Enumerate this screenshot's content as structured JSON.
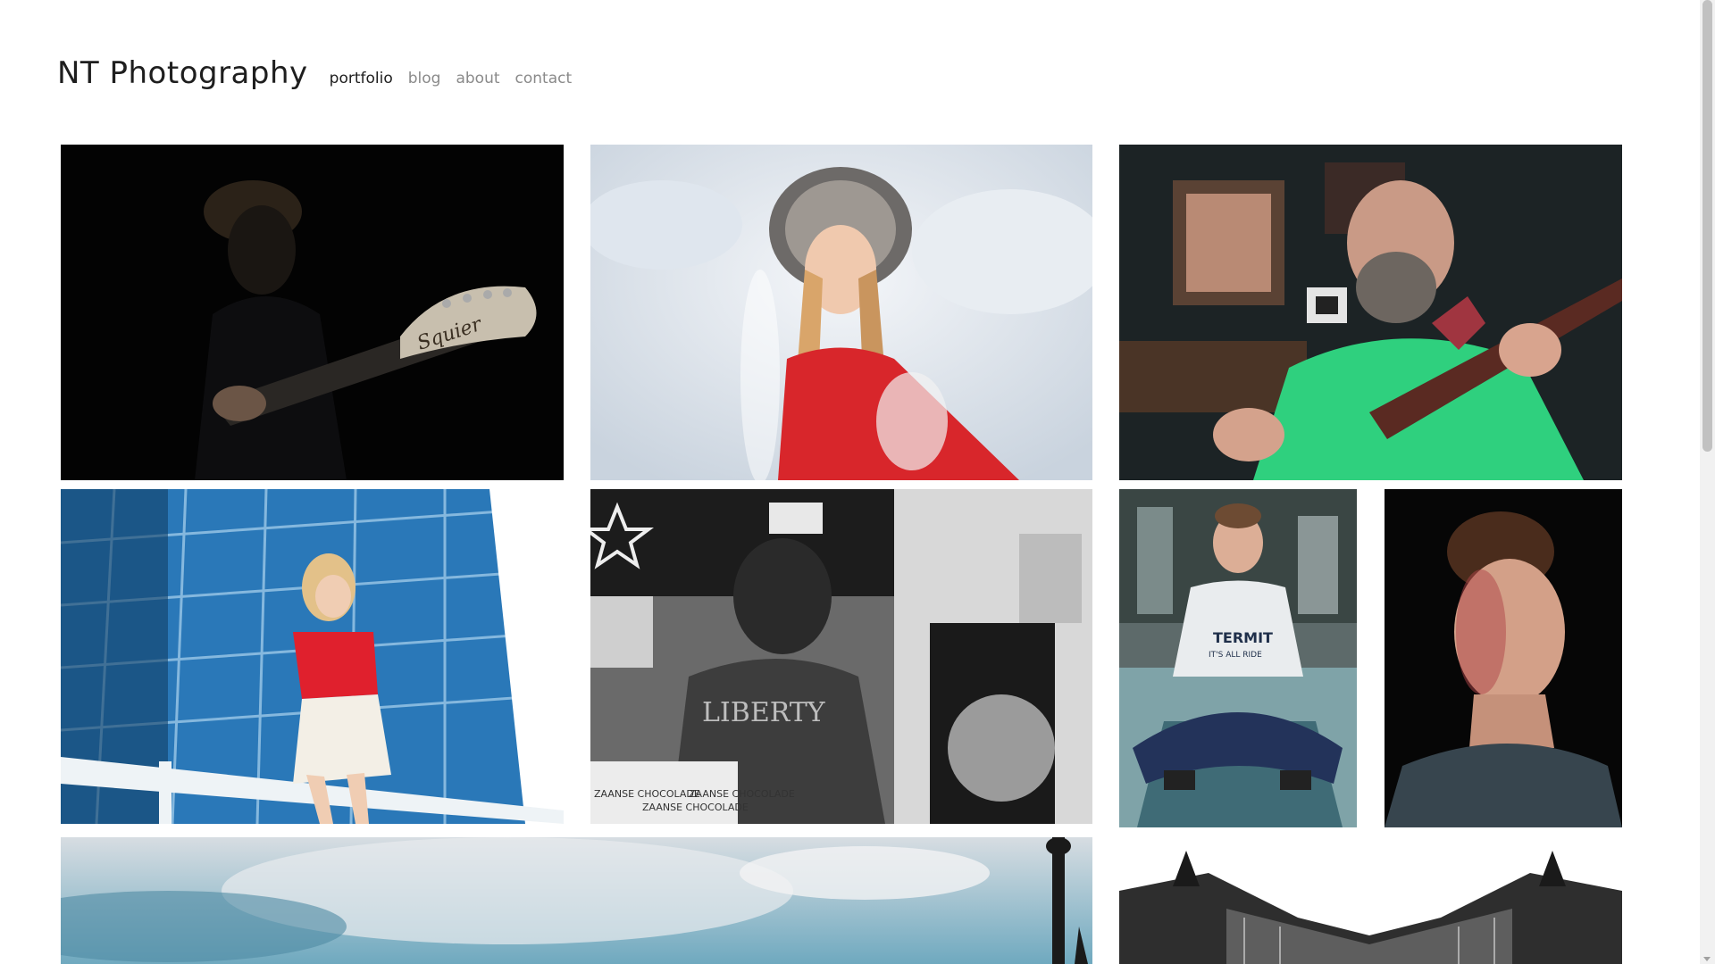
{
  "site": {
    "title": "NT Photography"
  },
  "nav": {
    "items": [
      {
        "label": "portfolio",
        "active": true
      },
      {
        "label": "blog",
        "active": false
      },
      {
        "label": "about",
        "active": false
      },
      {
        "label": "contact",
        "active": false
      }
    ]
  },
  "gallery": {
    "photos": [
      {
        "subject": "boy playing electric guitar in dark",
        "headstock_text": "Squier"
      },
      {
        "subject": "girl in fur hat in winter snow"
      },
      {
        "subject": "bearded man playing bass guitar in green t-shirt"
      },
      {
        "subject": "woman in red top sitting on railing by glass building"
      },
      {
        "subject": "black and white portrait of man at chocolate shop",
        "shirt_text": "LIBERTY",
        "package_text": [
          "ZAANSE CHOCOLADE",
          "ZAANSE CHOCOLADE",
          "ZAANSE CHOCOLADE"
        ]
      },
      {
        "subject": "young man sitting cross-legged on street",
        "shirt_text": [
          "TERMIT",
          "IT'S ALL RIDE"
        ]
      },
      {
        "subject": "young man portrait with dark background"
      },
      {
        "subject": "city skyline with sky and lamppost (partially visible)"
      },
      {
        "subject": "black and white cathedral architecture (partially visible)"
      }
    ]
  },
  "colors": {
    "title": "#1e1e1e",
    "nav_inactive": "#8a8a8a",
    "nav_active": "#1e1e1e",
    "background": "#ffffff"
  }
}
